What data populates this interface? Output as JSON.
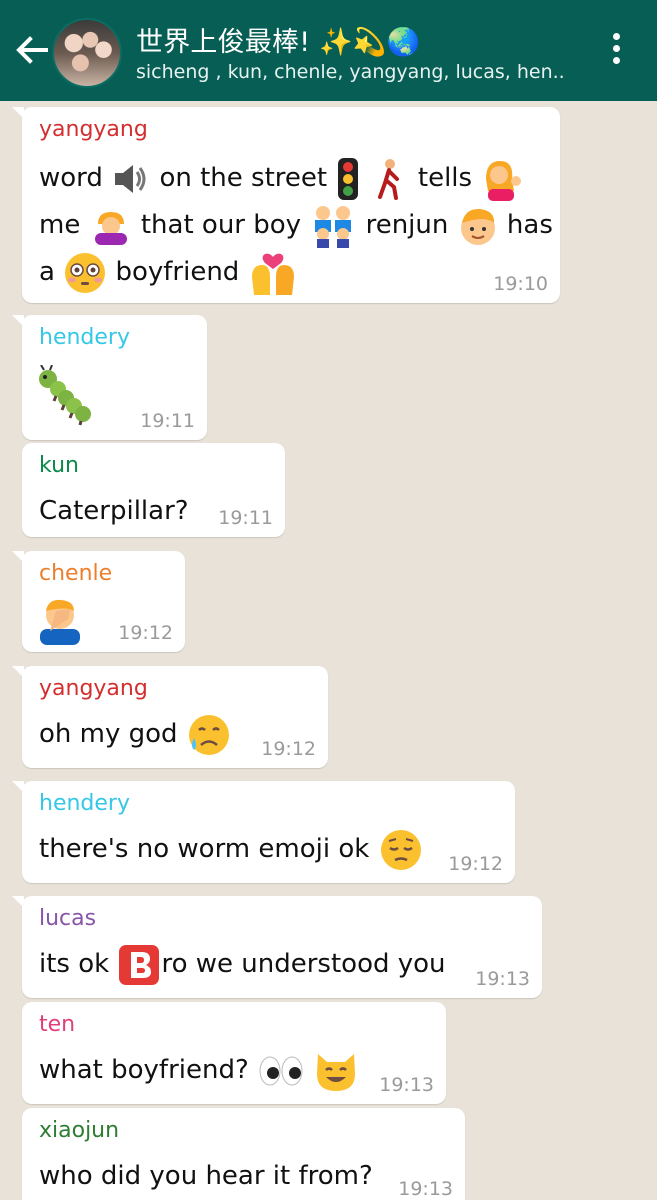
{
  "header": {
    "title": "世界上俊最棒! ✨💫🌏",
    "subtitle": "sicheng , kun, chenle, yangyang, lucas, hen.."
  },
  "colors": {
    "appbar": "#075e54",
    "yangyang": "#d32f2f",
    "hendery": "#35c8e6",
    "kun": "#0b8a4a",
    "chenle": "#ec7f2c",
    "lucas": "#8755a8",
    "ten": "#e23e7a",
    "xiaojun": "#2e7d32"
  },
  "messages": [
    {
      "sender": "yangyang",
      "time": "19:10",
      "line1a": "word",
      "line1b": "on the street",
      "line1c": "tells",
      "line2a": "me",
      "line2b": "that our boy",
      "line2c": "renjun",
      "line2d": "has",
      "line3a": "a",
      "line3b": "boyfriend",
      "emojis": [
        "speaker-icon",
        "traffic-light-icon",
        "walking-man-icon",
        "woman-tipping-hand-icon",
        "bowing-woman-icon",
        "family-icon",
        "boy-face-icon",
        "flushed-face-icon",
        "kissing-couple-icon"
      ]
    },
    {
      "sender": "hendery",
      "time": "19:11",
      "emojis": [
        "caterpillar-icon"
      ]
    },
    {
      "sender": "kun",
      "time": "19:11",
      "text": "Caterpillar?"
    },
    {
      "sender": "chenle",
      "time": "19:12",
      "emojis": [
        "facepalm-icon"
      ]
    },
    {
      "sender": "yangyang",
      "time": "19:12",
      "text": "oh my god",
      "emojis": [
        "sad-sweat-face-icon"
      ]
    },
    {
      "sender": "hendery",
      "time": "19:12",
      "text": "there's no worm emoji ok",
      "emojis": [
        "pensive-face-icon"
      ]
    },
    {
      "sender": "lucas",
      "time": "19:13",
      "text_a": "its ok",
      "text_b": "ro we understood you",
      "emojis": [
        "b-button-icon"
      ]
    },
    {
      "sender": "ten",
      "time": "19:13",
      "text": "what boyfriend?",
      "emojis": [
        "eyes-icon",
        "grinning-cat-icon"
      ]
    },
    {
      "sender": "xiaojun",
      "time": "19:13",
      "text": "who did you hear it from?"
    }
  ]
}
